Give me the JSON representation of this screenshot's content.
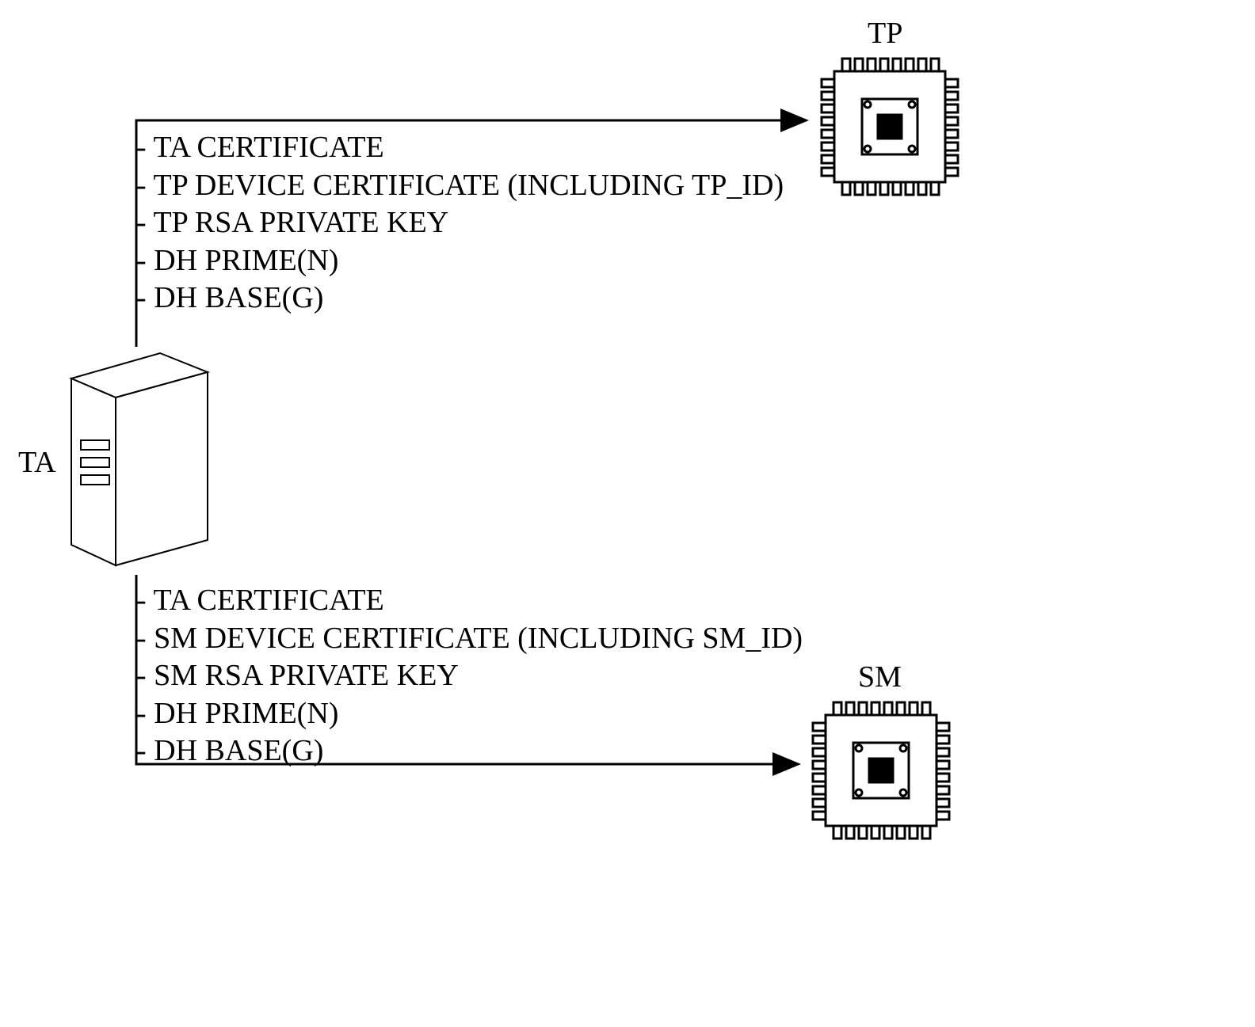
{
  "labels": {
    "ta": "TA",
    "tp": "TP",
    "sm": "SM"
  },
  "tp_items": {
    "l1": "- TA CERTIFICATE",
    "l2": "- TP DEVICE CERTIFICATE (INCLUDING TP_ID)",
    "l3": "- TP RSA PRIVATE KEY",
    "l4": "- DH PRIME(N)",
    "l5": "- DH BASE(G)"
  },
  "sm_items": {
    "l1": "- TA CERTIFICATE",
    "l2": "- SM DEVICE CERTIFICATE (INCLUDING SM_ID)",
    "l3": "- SM RSA PRIVATE KEY",
    "l4": "- DH PRIME(N)",
    "l5": "- DH BASE(G)"
  }
}
